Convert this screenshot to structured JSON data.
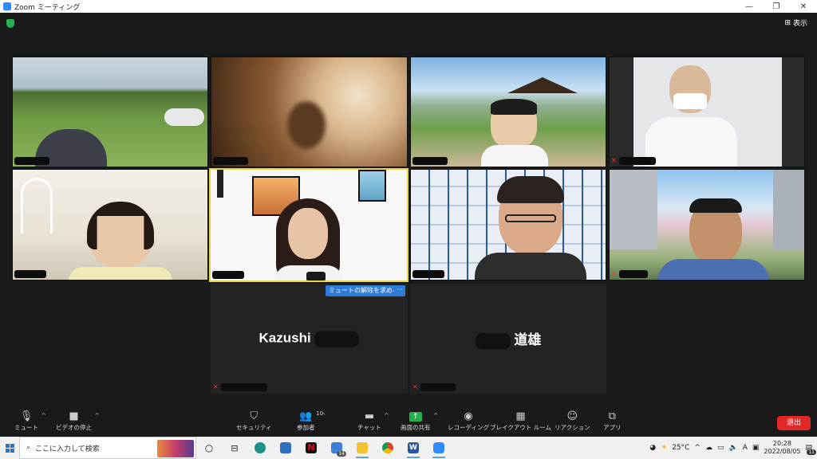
{
  "window": {
    "title": "Zoom ミーティング",
    "minimize": "—",
    "maximize": "❐",
    "close": "✕"
  },
  "header": {
    "view_label": "表示",
    "view_icon": "grid-icon"
  },
  "participants": {
    "kazushi_name": "Kazushi",
    "michio_name": "道雄"
  },
  "unmute_request": {
    "label": "ミュートの解除を求める",
    "more_label": "···"
  },
  "toolbar": {
    "mute_label": "ミュート",
    "video_label": "ビデオの停止",
    "security_label": "セキュリティ",
    "participants_label": "参加者",
    "participants_count": "10",
    "chat_label": "チャット",
    "share_label": "画面の共有",
    "record_label": "レコーディング",
    "breakout_label": "ブレイクアウト ルーム",
    "reactions_label": "リアクション",
    "apps_label": "アプリ",
    "end_label": "退出"
  },
  "taskbar": {
    "search_placeholder": "ここに入力して検索",
    "mail_badge": "14",
    "temperature": "25°C",
    "ime": "A",
    "time": "20:28",
    "date": "2022/08/05",
    "notification_count": "11"
  },
  "colors": {
    "accent_blue": "#2d7bd7",
    "end_red": "#e02828",
    "share_green": "#23b14d",
    "active_speaker": "#e6d44a"
  }
}
